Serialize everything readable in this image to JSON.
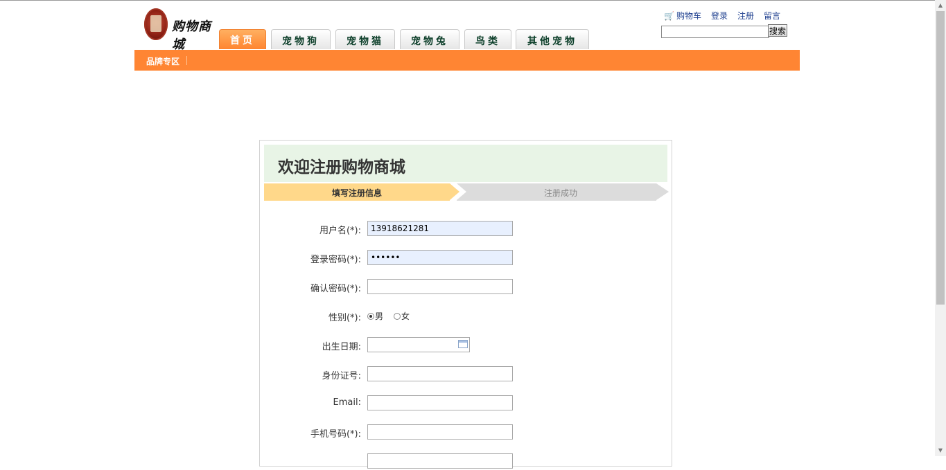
{
  "header": {
    "logo_text": "购物商城",
    "nav_tabs": [
      {
        "label": "首页",
        "active": true
      },
      {
        "label": "宠物狗",
        "active": false
      },
      {
        "label": "宠物猫",
        "active": false
      },
      {
        "label": "宠物兔",
        "active": false
      },
      {
        "label": "鸟类",
        "active": false
      },
      {
        "label": "其他宠物",
        "active": false
      }
    ],
    "top_links": {
      "cart": "购物车",
      "login": "登录",
      "register": "注册",
      "message": "留言"
    },
    "search": {
      "value": "",
      "button_label": "搜索"
    },
    "brand_zone": "品牌专区"
  },
  "panel": {
    "title": "欢迎注册购物商城",
    "steps": {
      "step1": "填写注册信息",
      "step2": "注册成功"
    },
    "fields": {
      "username_label": "用户名(*):",
      "username_value": "13918621281",
      "password_label": "登录密码(*):",
      "password_value": "••••••",
      "confirm_label": "确认密码(*):",
      "confirm_value": "",
      "gender_label": "性别(*):",
      "gender_male": "男",
      "gender_female": "女",
      "gender_selected": "男",
      "birth_label": "出生日期:",
      "birth_value": "",
      "idcard_label": "身份证号:",
      "idcard_value": "",
      "email_label": "Email:",
      "email_value": "",
      "phone_label": "手机号码(*):",
      "phone_value": ""
    }
  },
  "colors": {
    "accent_orange": "#ff8533",
    "panel_head_bg": "#e8f4e6",
    "step_active": "#ffd88a",
    "step_inactive": "#dcdcdc",
    "link_blue": "#1e3f8f"
  }
}
